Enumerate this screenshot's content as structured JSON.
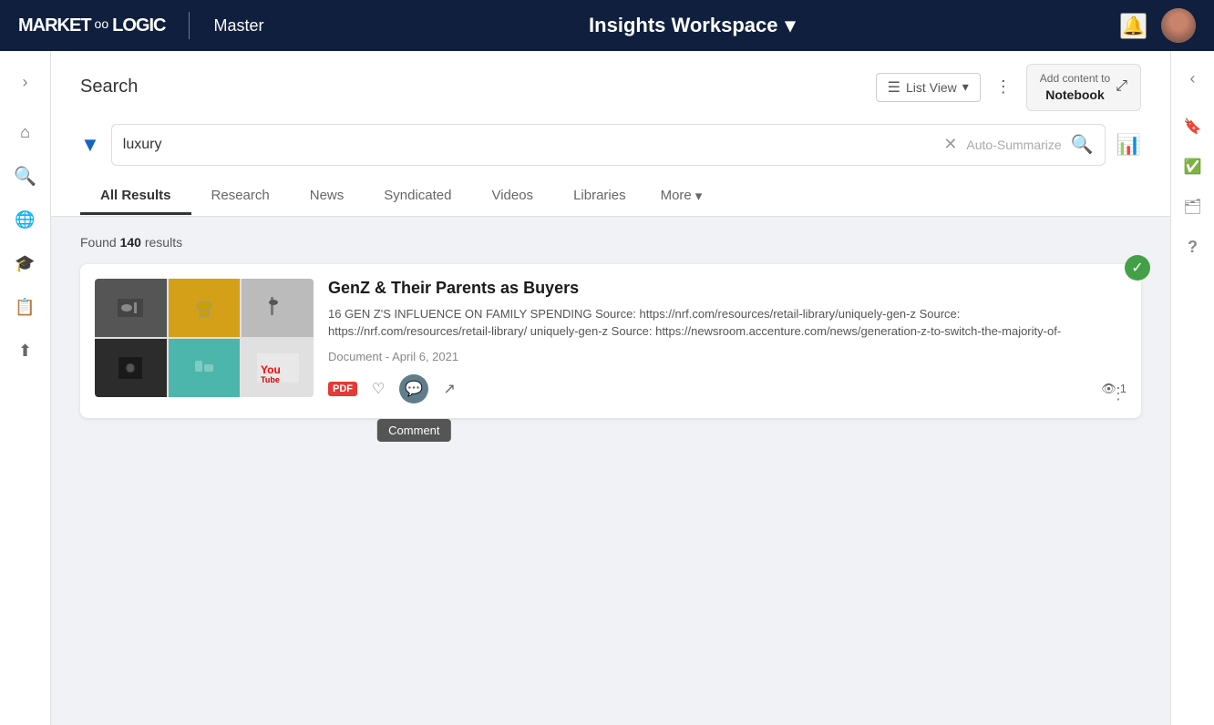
{
  "topnav": {
    "logo_text": "MARKET",
    "logo_subtext": "LOGIC",
    "product_name": "Master",
    "workspace_label": "Insights Workspace",
    "workspace_arrow": "▾"
  },
  "header": {
    "title": "Search",
    "list_view_label": "List View",
    "add_notebook_line1": "Add content to",
    "add_notebook_line2": "Notebook",
    "expand_icon": "⤢"
  },
  "search": {
    "query": "luxury",
    "placeholder": "Auto-Summarize"
  },
  "tabs": {
    "items": [
      {
        "id": "all",
        "label": "All Results",
        "active": true
      },
      {
        "id": "research",
        "label": "Research",
        "active": false
      },
      {
        "id": "news",
        "label": "News",
        "active": false
      },
      {
        "id": "syndicated",
        "label": "Syndicated",
        "active": false
      },
      {
        "id": "videos",
        "label": "Videos",
        "active": false
      },
      {
        "id": "libraries",
        "label": "Libraries",
        "active": false
      },
      {
        "id": "more",
        "label": "More",
        "active": false
      }
    ]
  },
  "results": {
    "found_label": "Found",
    "count": "140",
    "results_label": "results",
    "cards": [
      {
        "title": "GenZ & Their Parents as Buyers",
        "excerpt": "16 GEN Z'S INFLUENCE ON FAMILY SPENDING Source: https://nrf.com/resources/retail-library/uniquely-gen-z Source: https://nrf.com/resources/retail-library/ uniquely-gen-z Source: https://newsroom.accenture.com/news/generation-z-to-switch-the-majority-of-",
        "meta": "Document - April 6, 2021",
        "views": "1",
        "pdf_label": "PDF"
      }
    ]
  },
  "sidebar_left": {
    "icons": [
      {
        "name": "chevron-right",
        "symbol": "›"
      },
      {
        "name": "home",
        "symbol": "⌂"
      },
      {
        "name": "search",
        "symbol": "⚲"
      },
      {
        "name": "globe",
        "symbol": "🌐"
      },
      {
        "name": "graduation-cap",
        "symbol": "🎓"
      },
      {
        "name": "document-list",
        "symbol": "📋"
      },
      {
        "name": "upload",
        "symbol": "⬆"
      }
    ]
  },
  "sidebar_right": {
    "icons": [
      {
        "name": "chevron-left",
        "symbol": "‹"
      },
      {
        "name": "bookmark",
        "symbol": "🔖"
      },
      {
        "name": "check-document",
        "symbol": "📄"
      },
      {
        "name": "tray",
        "symbol": "🗂"
      },
      {
        "name": "help",
        "symbol": "?"
      }
    ]
  },
  "tooltip": {
    "comment_label": "Comment"
  }
}
